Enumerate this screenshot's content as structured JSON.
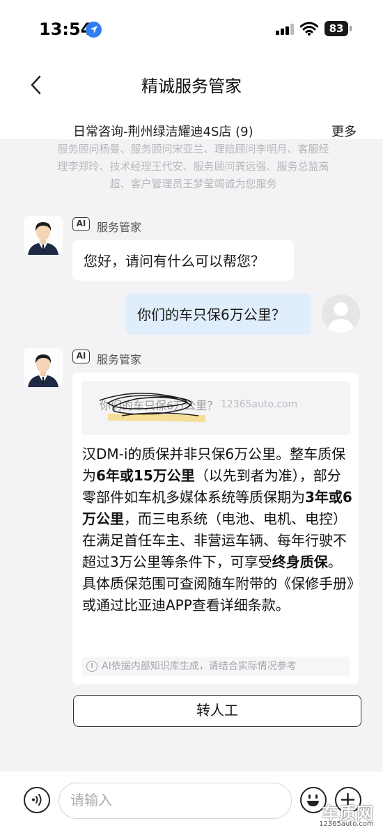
{
  "status_bar": {
    "time": "13:54",
    "battery": "83"
  },
  "nav": {
    "title": "精诚服务管家"
  },
  "store": {
    "name": "日常咨询-荆州绿洁耀迪4S店 (9)",
    "more_label": "更多",
    "staff_lines": [
      "服务顾问杨曼、服务顾问宋亚兰、理赔顾问李明月、客服经",
      "理李郑玲、技术经理王代安、服务顾问龚远强、服务总监高",
      "超、客户管理员王梦莹竭诚为您服务"
    ]
  },
  "messages": {
    "bot_name": "服务管家",
    "ai_badge": "AI",
    "greeting": "您好，请问有什么可以帮您？",
    "user_question": "你们的车只保6万公里？",
    "quote": "你们的车只保6万公里？",
    "quote_watermark": "12365auto.com",
    "answer": {
      "p1": "汉DM-i的质保并非只保6万公里。整车质保为",
      "b1": "6年或15万公里",
      "p2": "（以先到者为准），部分零部件如车机多媒体系统等质保期为",
      "b2": "3年或6万公里",
      "p3": "，而三电系统（电池、电机、电控）在满足首任车主、非营运车辆、每年行驶不超过3万公里等条件下，可享受",
      "b3": "终身质保",
      "p4": "。具体质保范围可查阅随车附带的《保修手册》或通过比亚迪APP查看详细条款。"
    },
    "disclaimer": "AI依据内部知识库生成，请结合实际情况参考"
  },
  "transfer_label": "转人工",
  "input": {
    "placeholder": "请输入"
  },
  "watermark": {
    "main": "车质网",
    "url": "12365auto.com"
  },
  "colors": {
    "accent_blue": "#2f7cf6",
    "user_bubble": "#e0eefc",
    "background": "#f3f3f5"
  }
}
